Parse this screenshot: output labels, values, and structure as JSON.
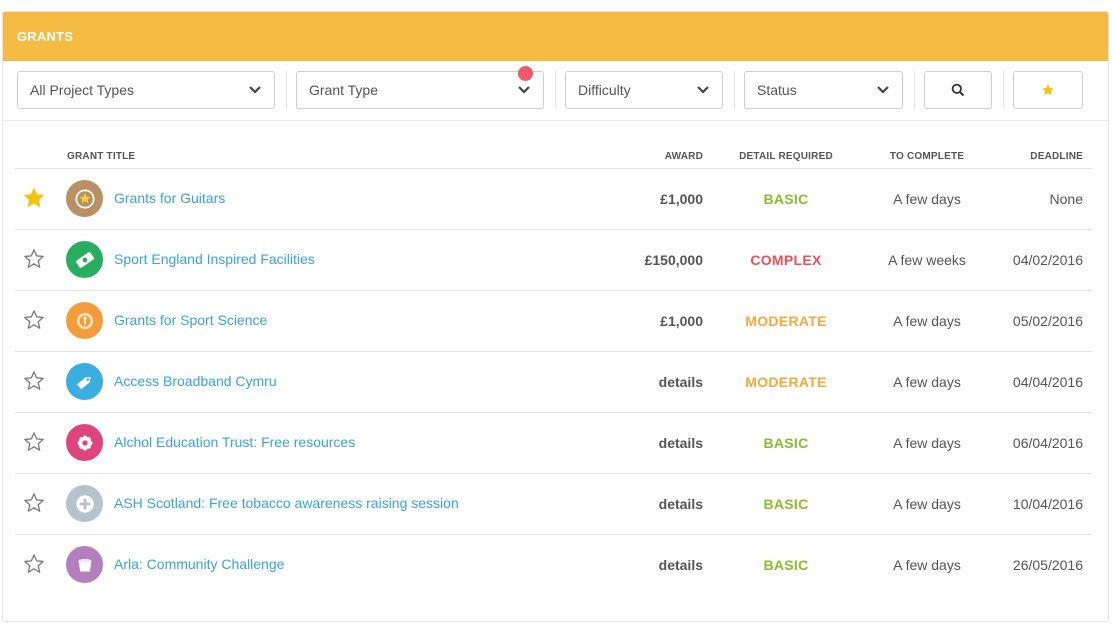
{
  "header": {
    "title": "GRANTS"
  },
  "filters": {
    "project_type": "All Project Types",
    "grant_type": "Grant Type",
    "difficulty": "Difficulty",
    "status": "Status",
    "search_icon": "search-icon",
    "favorites_icon": "star-icon"
  },
  "columns": {
    "title": "GRANT TITLE",
    "award": "AWARD",
    "detail": "DETAIL REQUIRED",
    "complete": "TO COMPLETE",
    "deadline": "DEADLINE"
  },
  "colors": {
    "header": "#f5bb42",
    "link": "#3aa4d8",
    "basic": "#8dbb2e",
    "complex": "#e8505b",
    "moderate": "#f3a93c",
    "star_active": "#f1c40f",
    "notification": "#ec5a6a"
  },
  "rows": [
    {
      "starred": true,
      "icon": "medal-icon",
      "icon_bg": "#b98f63",
      "title": "Grants for Guitars",
      "award": "£1,000",
      "detail": "BASIC",
      "complete": "A few days",
      "deadline": "None"
    },
    {
      "starred": false,
      "icon": "banknote-icon",
      "icon_bg": "#27ae60",
      "title": "Sport England Inspired Facilities",
      "award": "£150,000",
      "detail": "COMPLEX",
      "complete": "A few weeks",
      "deadline": "04/02/2016"
    },
    {
      "starred": false,
      "icon": "badge-icon",
      "icon_bg": "#f39c3b",
      "title": "Grants for Sport Science",
      "award": "£1,000",
      "detail": "MODERATE",
      "complete": "A few days",
      "deadline": "05/02/2016"
    },
    {
      "starred": false,
      "icon": "tag-icon",
      "icon_bg": "#3aaee0",
      "title": "Access Broadband Cymru",
      "award": "details",
      "detail": "MODERATE",
      "complete": "A few days",
      "deadline": "04/04/2016"
    },
    {
      "starred": false,
      "icon": "flower-icon",
      "icon_bg": "#e0447f",
      "title": "Alchol Education Trust: Free resources",
      "award": "details",
      "detail": "BASIC",
      "complete": "A few days",
      "deadline": "06/04/2016"
    },
    {
      "starred": false,
      "icon": "plus-icon",
      "icon_bg": "#b6c2cc",
      "title": "ASH Scotland: Free tobacco awareness raising session",
      "award": "details",
      "detail": "BASIC",
      "complete": "A few days",
      "deadline": "10/04/2016"
    },
    {
      "starred": false,
      "icon": "bucket-icon",
      "icon_bg": "#b47fbd",
      "title": "Arla: Community Challenge",
      "award": "details",
      "detail": "BASIC",
      "complete": "A few days",
      "deadline": "26/05/2016"
    }
  ]
}
